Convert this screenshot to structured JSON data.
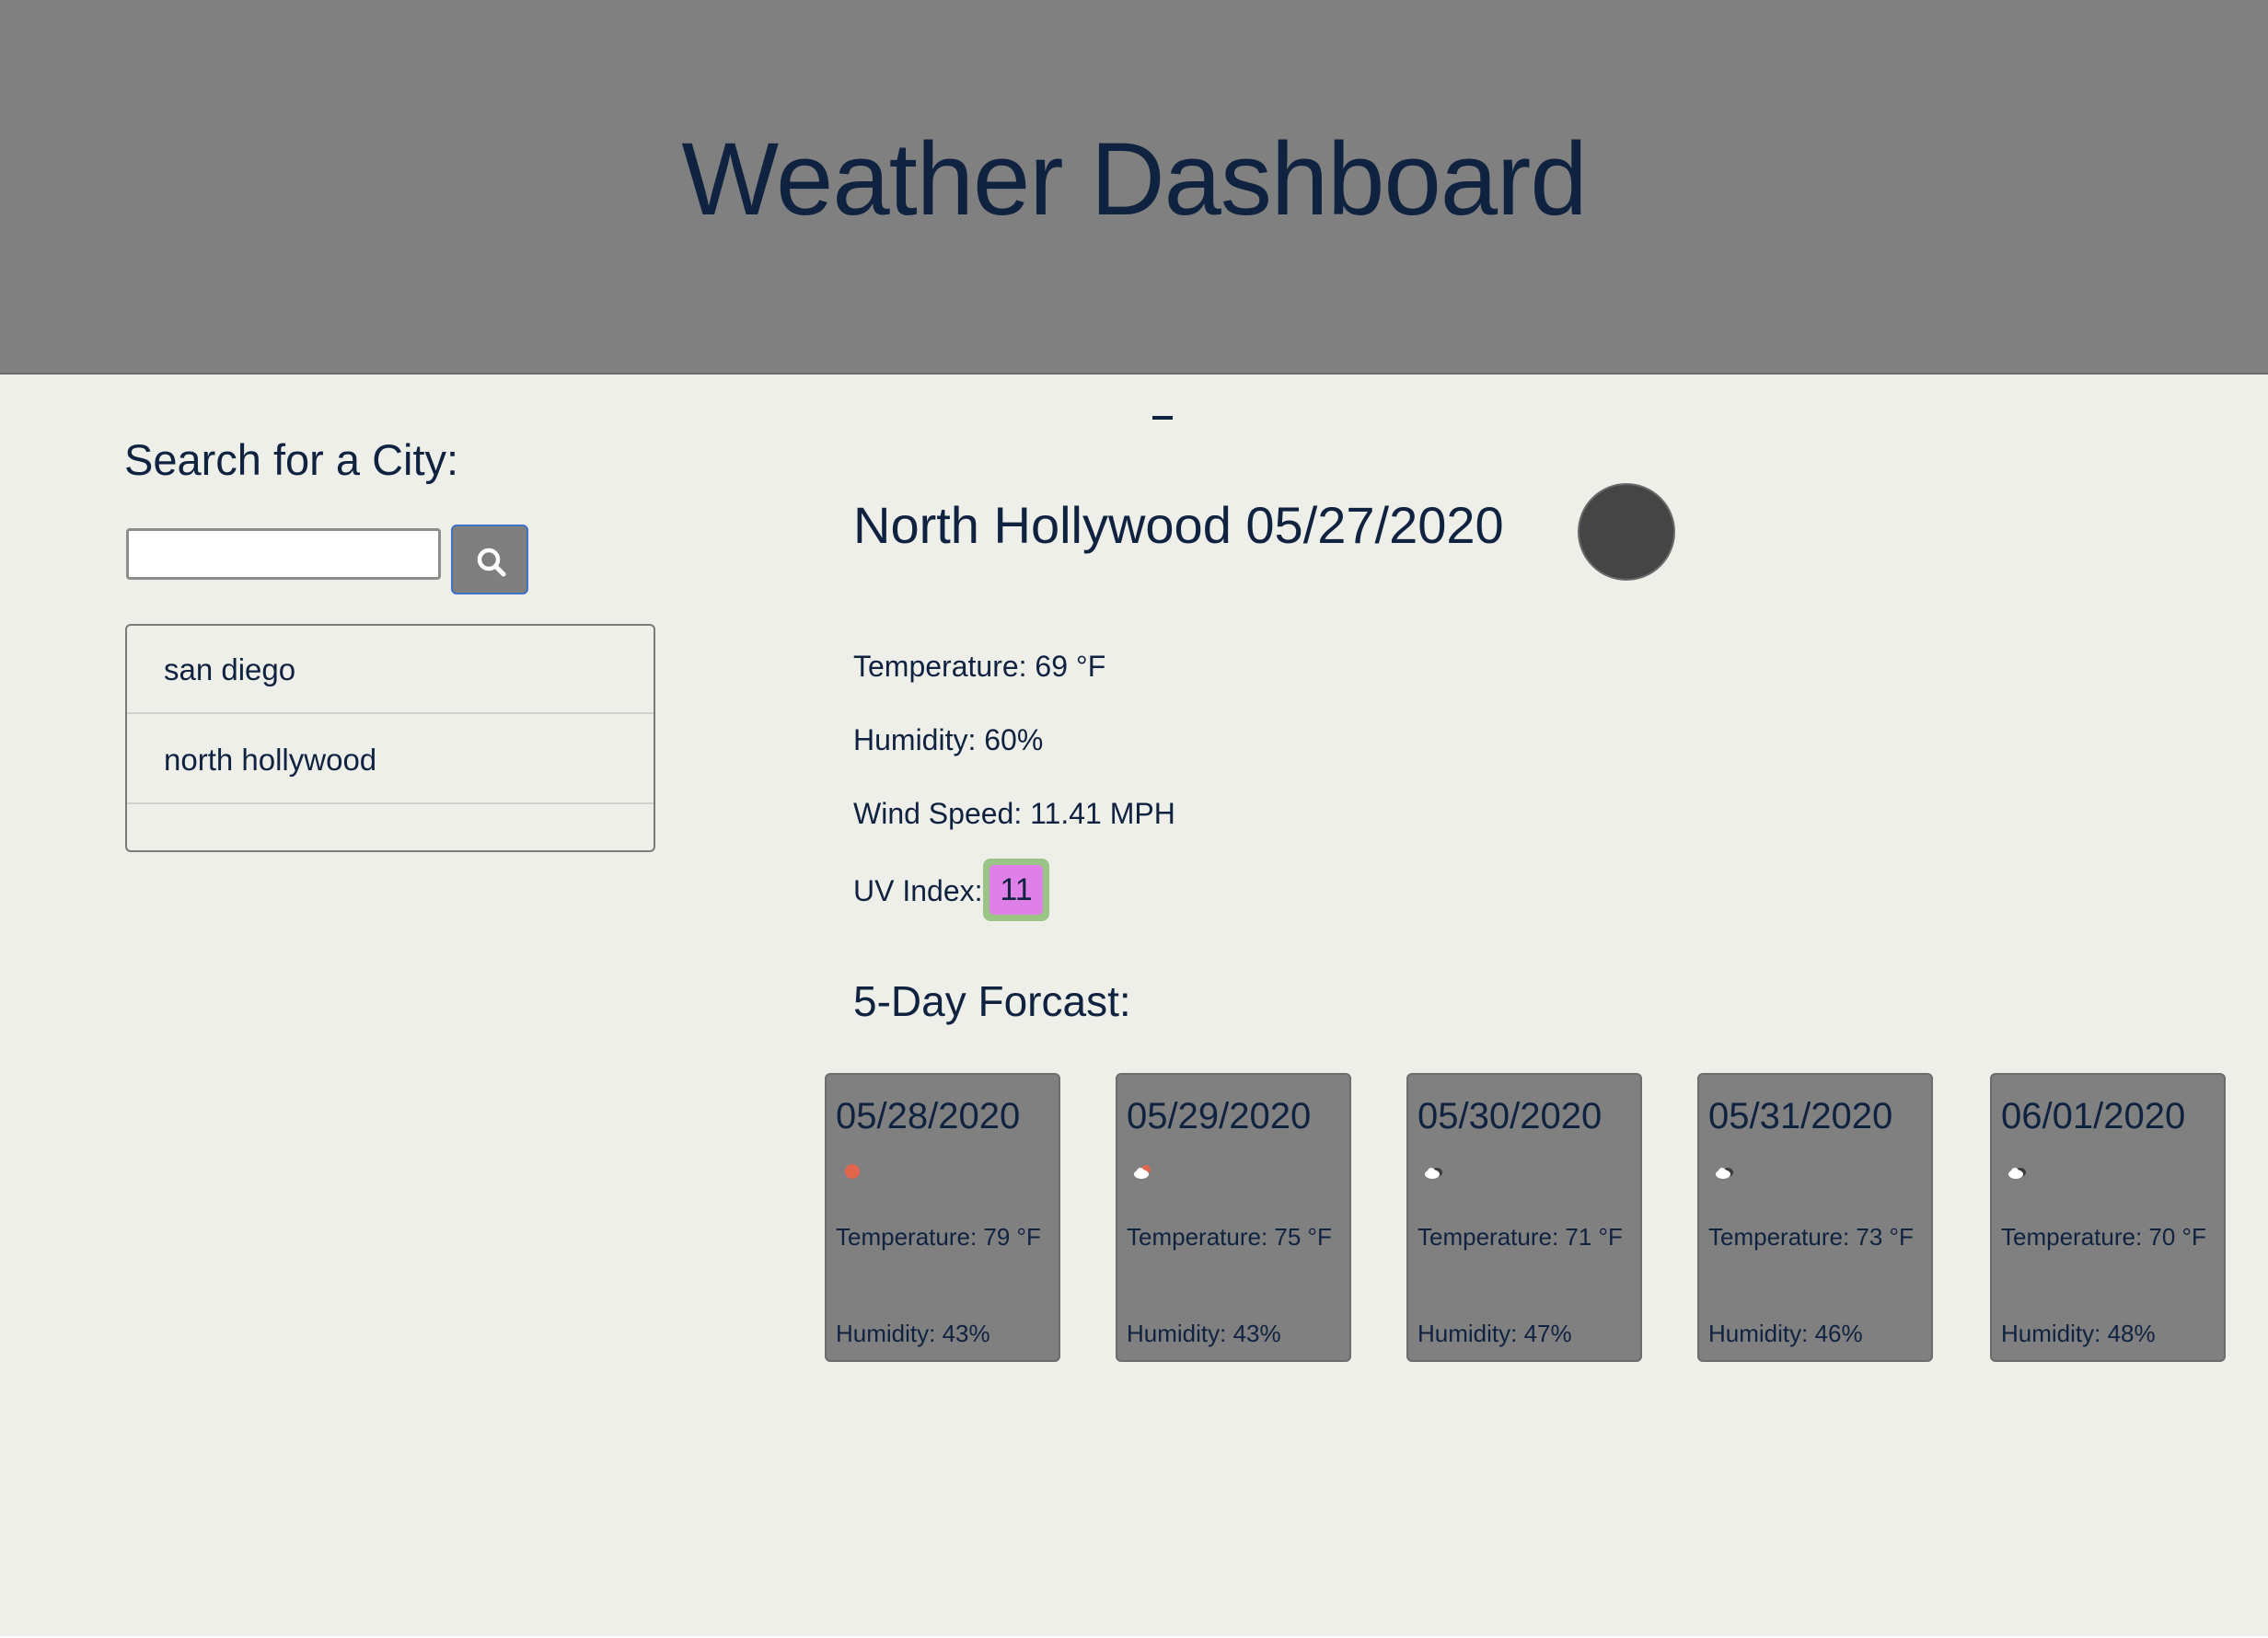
{
  "header": {
    "title": "Weather Dashboard"
  },
  "sidebar": {
    "search_label": "Search for a City:",
    "search_value": "",
    "search_icon": "search-icon",
    "history": [
      {
        "label": "san diego"
      },
      {
        "label": "north hollywood"
      },
      {
        "label": ""
      }
    ]
  },
  "current": {
    "separator": "-",
    "title": "North Hollywood 05/27/2020",
    "weather_icon": "weather-icon",
    "temperature": "Temperature: 69 °F",
    "humidity": "Humidity: 60%",
    "wind": "Wind Speed: 11.41 MPH",
    "uv_label": "UV Index:",
    "uv_value": "11",
    "uv_color": "#df7fe8"
  },
  "forecast": {
    "heading": "5-Day Forcast:",
    "days": [
      {
        "date": "05/28/2020",
        "icon": "sun-icon",
        "temp": "Temperature: 79 °F",
        "humidity": "Humidity: 43%"
      },
      {
        "date": "05/29/2020",
        "icon": "partly-cloudy-icon",
        "temp": "Temperature: 75 °F",
        "humidity": "Humidity: 43%"
      },
      {
        "date": "05/30/2020",
        "icon": "cloud-icon",
        "temp": "Temperature: 71 °F",
        "humidity": "Humidity: 47%"
      },
      {
        "date": "05/31/2020",
        "icon": "cloud-icon",
        "temp": "Temperature: 73 °F",
        "humidity": "Humidity: 46%"
      },
      {
        "date": "06/01/2020",
        "icon": "cloud-icon",
        "temp": "Temperature: 70 °F",
        "humidity": "Humidity: 48%"
      }
    ]
  },
  "colors": {
    "header_bg": "#808080",
    "page_bg": "#efefea",
    "text": "#0f2240",
    "card_bg": "#808080",
    "button_border": "#3b73c6"
  }
}
